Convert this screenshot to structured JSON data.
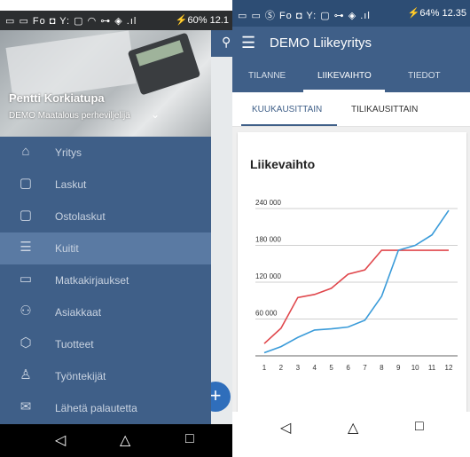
{
  "left_phone": {
    "status_left": "▭ ▭ Fo ◘ Y: ▢ ◠ ⊶ ◈ .ıl",
    "status_right": "⚡60% 12.1",
    "user_name": "Pentti Korkiatupa",
    "company": "DEMO Maatalous perheviljelijä",
    "menu": [
      {
        "label": "Yritys",
        "icon": "factory-icon",
        "glyph": "⌂"
      },
      {
        "label": "Laskut",
        "icon": "clipboard-icon",
        "glyph": "▢"
      },
      {
        "label": "Ostolaskut",
        "icon": "clipboard-icon",
        "glyph": "▢"
      },
      {
        "label": "Kuitit",
        "icon": "receipt-icon",
        "glyph": "☰",
        "selected": true
      },
      {
        "label": "Matkakirjaukset",
        "icon": "car-icon",
        "glyph": "▭"
      },
      {
        "label": "Asiakkaat",
        "icon": "people-icon",
        "glyph": "⚇"
      },
      {
        "label": "Tuotteet",
        "icon": "box-icon",
        "glyph": "⬡"
      },
      {
        "label": "Työntekijät",
        "icon": "worker-icon",
        "glyph": "♙"
      },
      {
        "label": "Lähetä palautetta",
        "icon": "feedback-icon",
        "glyph": "✉"
      }
    ]
  },
  "right_phone": {
    "status_left": "▭ ▭ Ⓢ Fo ◘ Y: ▢ ⊶ ◈ .ıl",
    "status_right": "⚡64% 12.35",
    "app_title": "DEMO Liikeyritys",
    "tabs": [
      "TILANNE",
      "LIIKEVAIHTO",
      "TIEDOT"
    ],
    "active_tab": "LIIKEVAIHTO",
    "subtabs": [
      "KUUKAUSITTAIN",
      "TILIKAUSITTAIN"
    ],
    "active_subtab": "KUUKAUSITTAIN"
  },
  "colors": {
    "primary": "#3f5f88",
    "status_dark": "#2d4d74",
    "red_series": "#e0474c",
    "blue_series": "#3a9bd9"
  },
  "chart_data": {
    "type": "line",
    "title": "Liikevaihto",
    "x": [
      1,
      2,
      3,
      4,
      5,
      6,
      7,
      8,
      9,
      10,
      11,
      12
    ],
    "ylim": [
      0,
      240000
    ],
    "yticks": [
      60000,
      120000,
      180000,
      240000
    ],
    "ytick_labels": [
      "60 000",
      "120 000",
      "180 000",
      "240 000"
    ],
    "grid": true,
    "series": [
      {
        "color": "#e0474c",
        "values": [
          20000,
          45000,
          95000,
          100000,
          110000,
          133000,
          140000,
          172000,
          172000,
          172000,
          172000,
          172000
        ]
      },
      {
        "color": "#3a9bd9",
        "values": [
          5000,
          15000,
          30000,
          42000,
          44000,
          47000,
          58000,
          97000,
          172000,
          180000,
          197000,
          237000
        ]
      }
    ]
  }
}
